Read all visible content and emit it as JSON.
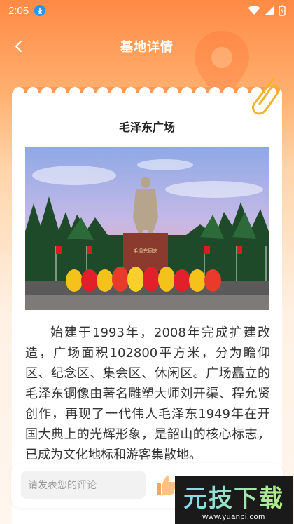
{
  "status": {
    "time": "2:05"
  },
  "nav": {
    "title": "基地详情"
  },
  "place": {
    "name": "毛泽东广场",
    "photo_plaque": "毛泽东同志",
    "description": "始建于1993年，2008年完成扩建改造，广场面积102800平方米，分为瞻仰区、纪念区、集会区、休闲区。广场矗立的毛泽东铜像由著名雕塑大师刘开渠、程允贤创作，再现了一代伟人毛泽东1949年在开国大典上的光辉形象，是韶山的核心标志，已成为文化地标和游客集散地。"
  },
  "comment": {
    "placeholder": "请发表您的评论"
  },
  "watermark": {
    "brand": "元技下载",
    "url": "www.yuanpi.com"
  }
}
